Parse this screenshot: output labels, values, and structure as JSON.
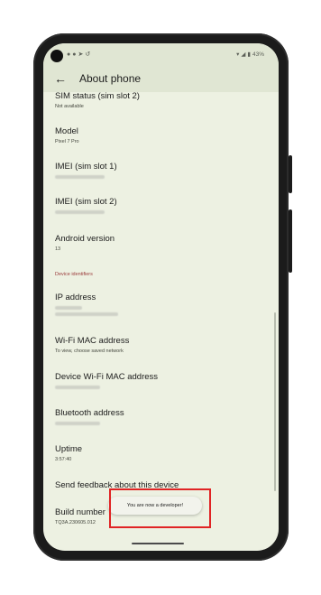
{
  "status_bar": {
    "battery_percent": "43%"
  },
  "app_bar": {
    "back_icon": "arrow-back-icon",
    "title": "About phone"
  },
  "preferences": [
    {
      "key": "sim_status",
      "title": "SIM status (sim slot 2)",
      "summary": "Not available"
    },
    {
      "key": "model",
      "title": "Model",
      "summary": "Pixel 7 Pro"
    },
    {
      "key": "imei1",
      "title": "IMEI (sim slot 1)",
      "summary": ""
    },
    {
      "key": "imei2",
      "title": "IMEI (sim slot 2)",
      "summary": ""
    },
    {
      "key": "android_version",
      "title": "Android version",
      "summary": "13"
    },
    {
      "key": "ip_address",
      "title": "IP address",
      "summary": ""
    },
    {
      "key": "wifi_mac",
      "title": "Wi-Fi MAC address",
      "summary": "To view, choose saved network"
    },
    {
      "key": "device_wifi_mac",
      "title": "Device Wi-Fi MAC address",
      "summary": ""
    },
    {
      "key": "bluetooth",
      "title": "Bluetooth address",
      "summary": ""
    },
    {
      "key": "uptime",
      "title": "Uptime",
      "summary": "3:57:40"
    },
    {
      "key": "feedback",
      "title": "Send feedback about this device",
      "summary": ""
    },
    {
      "key": "build_number",
      "title": "Build number",
      "summary": "TQ3A.230605.012"
    }
  ],
  "category_device_identifiers": "Device identifiers",
  "toast": {
    "message": "You are now a developer!"
  },
  "colors": {
    "screen_bg": "#edf1e2",
    "app_bar_bg": "#e0e6d3",
    "category_text": "#9b3b3b",
    "highlight": "#e02424"
  }
}
